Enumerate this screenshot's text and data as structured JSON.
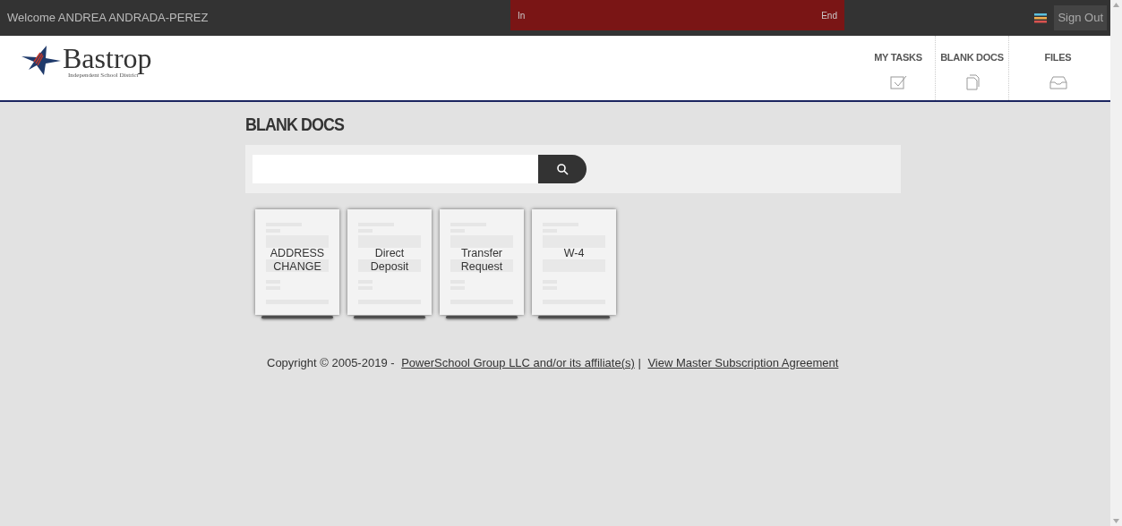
{
  "top_bar": {
    "welcome": "Welcome ANDREA ANDRADA-PEREZ",
    "banner": {
      "start": "In",
      "end": "End"
    },
    "sign_out": "Sign Out"
  },
  "logo": {
    "name": "Bastrop",
    "subtitle": "Independent School District"
  },
  "nav": [
    {
      "label": "MY TASKS",
      "kind": "check",
      "selected": false
    },
    {
      "label": "BLANK DOCS",
      "kind": "docs",
      "selected": false
    },
    {
      "label": "FILES",
      "kind": "tray",
      "selected": false
    }
  ],
  "page_title": "BLANK DOCS",
  "docs": [
    {
      "label": "ADDRESS CHANGE"
    },
    {
      "label": "Direct Deposit"
    },
    {
      "label": "Transfer Request"
    },
    {
      "label": "W-4"
    }
  ],
  "footer": {
    "copyright": "Copyright © 2005-2019 -",
    "link": "PowerSchool Group LLC and/or its affiliate(s)",
    "separator": "|",
    "agreement": "View Master Subscription Agreement"
  }
}
